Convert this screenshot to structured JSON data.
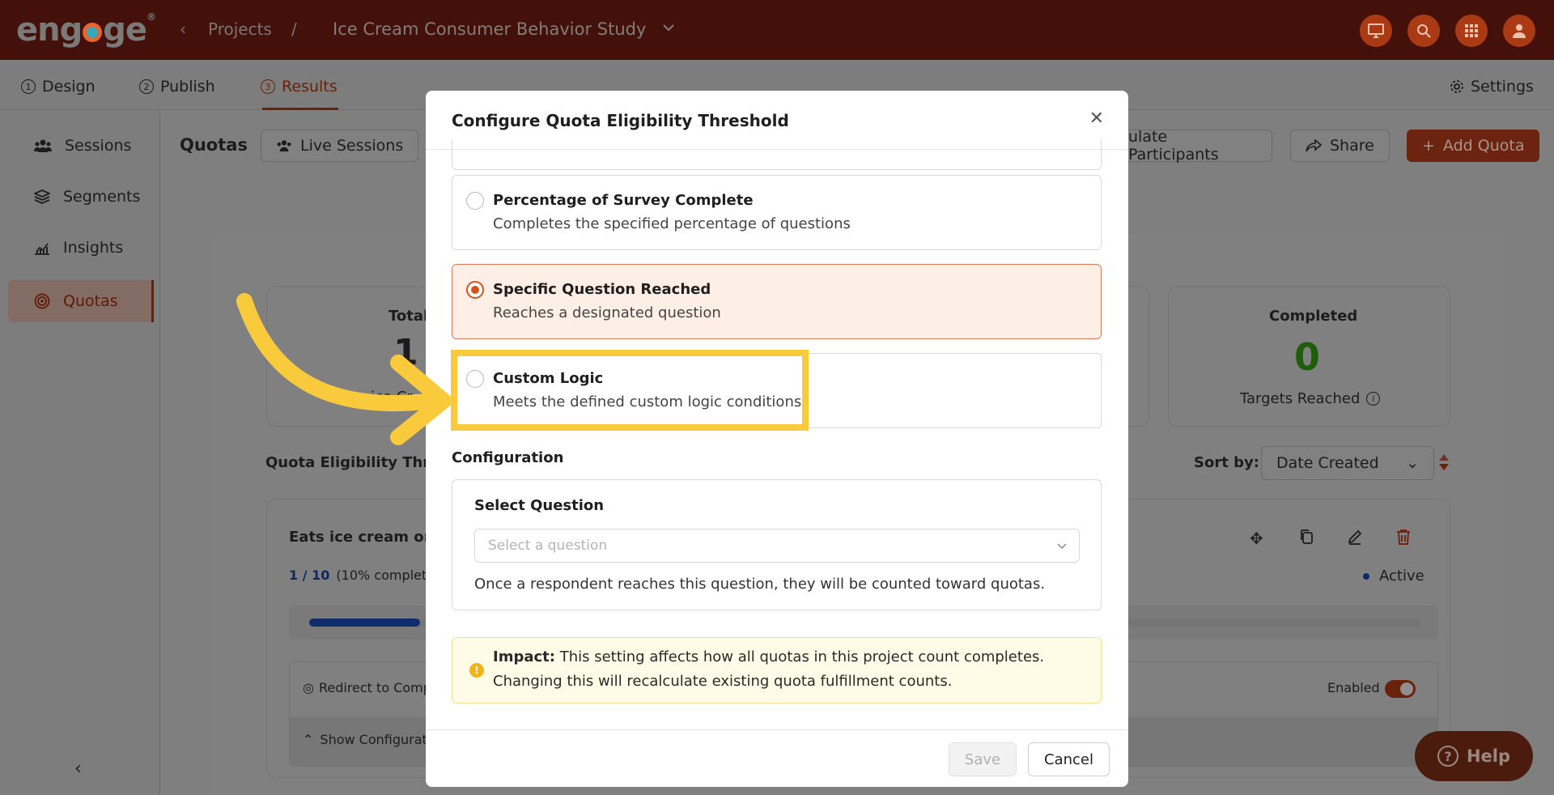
{
  "topbar": {
    "logo": "engage",
    "back_icon": "chevron-left-icon",
    "projects_label": "Projects",
    "separator": "/",
    "project_title": "Ice Cream Consumer Behavior Study",
    "icons": [
      "presentation-icon",
      "search-icon",
      "apps-grid-icon",
      "user-icon"
    ]
  },
  "tabs": [
    {
      "num": "1",
      "label": "Design"
    },
    {
      "num": "2",
      "label": "Publish"
    },
    {
      "num": "3",
      "label": "Results"
    }
  ],
  "settings_label": "Settings",
  "sidebar": {
    "items": [
      {
        "label": "Sessions",
        "icon": "users-icon"
      },
      {
        "label": "Segments",
        "icon": "layers-icon"
      },
      {
        "label": "Insights",
        "icon": "chart-icon"
      },
      {
        "label": "Quotas",
        "icon": "target-icon"
      }
    ]
  },
  "background": {
    "quotas_title": "Quotas",
    "live_sessions": "Live Sessions",
    "recalc_partial": "ulate Participants",
    "share": "Share",
    "add_quota": "Add Quota",
    "total_partial": "Total",
    "total_value_partial": "1",
    "total_sub_partial": "ice Cr",
    "completed_label": "Completed",
    "completed_value": "0",
    "targets_reached": "Targets Reached",
    "threshold_partial": "Quota Eligibility Thres",
    "sort_by": "Sort by:",
    "sort_value": "Date Created",
    "quota_name_partial": "Eats ice cream onc",
    "progress_text": "1 / 10",
    "progress_pct_partial": "(10% complete",
    "progress_fraction": 0.1,
    "status": "Active",
    "redirect_partial": "Redirect to Comp",
    "enabled": "Enabled",
    "show_config_partial": "Show Configurati"
  },
  "modal": {
    "title": "Configure Quota Eligibility Threshold",
    "options": [
      {
        "title": "Percentage of Survey Complete",
        "desc": "Completes the specified percentage of questions",
        "selected": false
      },
      {
        "title": "Specific Question Reached",
        "desc": "Reaches a designated question",
        "selected": true
      },
      {
        "title": "Custom Logic",
        "desc": "Meets the defined custom logic conditions",
        "selected": false
      }
    ],
    "config_heading": "Configuration",
    "select_question_label": "Select Question",
    "select_placeholder": "Select a question",
    "config_help": "Once a respondent reaches this question, they will be counted toward quotas.",
    "impact_label": "Impact:",
    "impact_text": "This setting affects how all quotas in this project count completes.",
    "impact_text2": "Changing this will recalculate existing quota fulfillment counts.",
    "save": "Save",
    "cancel": "Cancel"
  },
  "help_label": "Help",
  "colors": {
    "accent": "#d9501d",
    "highlight": "#f9cb3c",
    "topbar": "#431109"
  }
}
